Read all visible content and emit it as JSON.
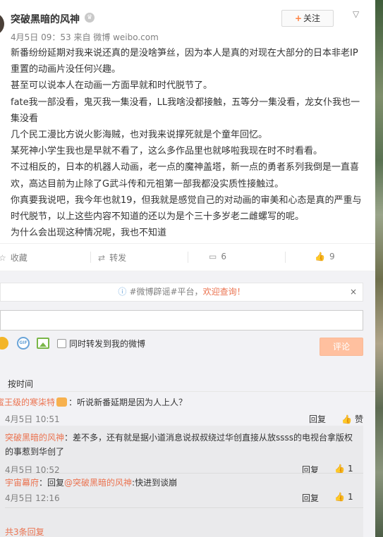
{
  "post": {
    "username": "突破黑暗的风神",
    "vip_icon": "crown-icon",
    "meta": "4月5日 09：53 来自 微博 weibo.com",
    "follow_label": "关注",
    "more_icon": "chevron-down-icon",
    "body": "新番纷纷延期对我来说还真的是没啥笋丝，因为本人是真的对现在大部分的日本非老IP重置的动画片没任何兴趣。\n甚至可以说本人在动画一方面早就和时代脱节了。\nfate我一部没看，鬼灭我一集没看，LL我啥没都接触，五等分一集没看，龙女仆我也一集没看\n几个民工漫比方说火影海贼，也对我来说撑死就是个童年回忆。\n某死神小学生我也是早就不看了，这么多作品里也就哆啦我现在时不时看看。\n不过相反的，日本的机器人动画，老一点的魔神盖塔，新一点的勇者系列我倒是一直喜欢，高达目前为止除了G武斗传和元祖第一部我都没实质性接触过。\n你真要我说吧，我今年也就19，但我就是感觉自己的对动画的审美和心态是真的严重与时代脱节，以上这些内容不知道的还以为是个三十多岁老二雌螺写的呢。\n为什么会出现这种情况呢，我也不知道"
  },
  "actions": {
    "favorite": "收藏",
    "repost": "转发",
    "comment": "6",
    "like": "9"
  },
  "comment_panel": {
    "notice_topic": "#微博辟谣#平台，",
    "notice_link": "欢迎查询！",
    "notice_close": "×",
    "repost_label": "同时转发到我的微博",
    "submit_label": "评论",
    "sort_label": "按时间",
    "first_comment": {
      "author": "蜜王级的寒柒特",
      "text": "：听说新番延期是因为人上人？",
      "time": "4月5日 10:51",
      "reply_label": "回复",
      "like_label": "赞"
    },
    "replies": [
      {
        "author": "突破黑暗的风神",
        "text": "：差不多，还有就是据小道消息说叔叔绕过华创直接从放ssss的电视台拿版权的事惹到华创了",
        "time": "4月5日 10:52",
        "reply_label": "回复",
        "likes": "1"
      },
      {
        "author": "宇宙幕府",
        "text_prefix": "：回复",
        "mention": "@突破黑暗的风神",
        "text": ":快进到谈崩",
        "time": "4月5日 12:16",
        "reply_label": "回复",
        "likes": "1"
      }
    ],
    "total_replies": "共3条回复"
  }
}
